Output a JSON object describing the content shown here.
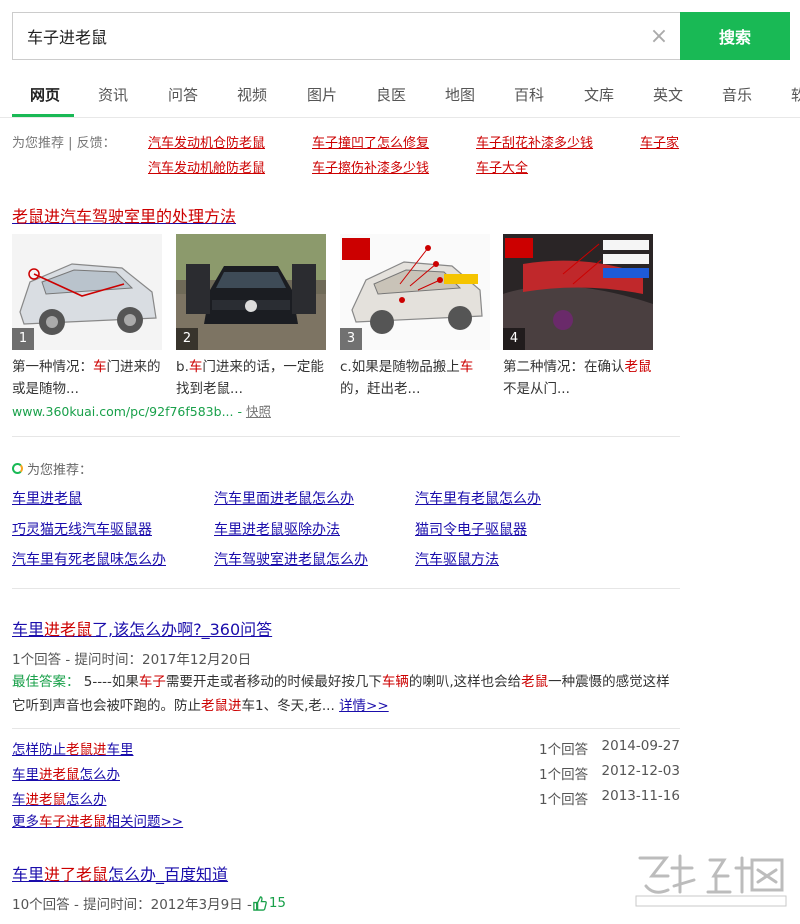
{
  "search": {
    "query": "车子进老鼠",
    "button": "搜索",
    "clear": "×"
  },
  "tabs": [
    "网页",
    "资讯",
    "问答",
    "视频",
    "图片",
    "良医",
    "地图",
    "百科",
    "文库",
    "英文",
    "音乐",
    "软"
  ],
  "recommend": {
    "label": "为您推荐 | 反馈：",
    "links": [
      "汽车发动机仓防老鼠",
      "车子撞凹了怎么修复",
      "车子刮花补漆多少钱",
      "车子家",
      "汽车发动机舱防老鼠",
      "车子擦伤补漆多少钱",
      "车子大全"
    ]
  },
  "result1": {
    "title": "老鼠进汽车驾驶室里的处理方法",
    "images": [
      {
        "num": "1",
        "cap_a": "第一种情况：",
        "cap_red": "车",
        "cap_b": "门进来的或是随物..."
      },
      {
        "num": "2",
        "cap_a": "b.",
        "cap_red": "车",
        "cap_b": "门进来的话，一定能找到老鼠..."
      },
      {
        "num": "3",
        "cap_a": "c.如果是随物品搬上",
        "cap_red": "车",
        "cap_b": "的，赶出老..."
      },
      {
        "num": "4",
        "cap_a": "第二种情况：在确认",
        "cap_red": "老鼠",
        "cap_b": "不是从门..."
      }
    ],
    "url": "www.360kuai.com/pc/92f76f583b...",
    "sep": " - ",
    "snapshot": "快照"
  },
  "related": {
    "heading": "为您推荐：",
    "links": [
      "车里进老鼠",
      "汽车里面进老鼠怎么办",
      "汽车里有老鼠怎么办",
      "巧灵猫无线汽车驱鼠器",
      "车里进老鼠驱除办法",
      "猫司令电子驱鼠器",
      "汽车里有死老鼠味怎么办",
      "汽车驾驶室进老鼠怎么办",
      "汽车驱鼠方法"
    ]
  },
  "result2": {
    "title_a": "车里",
    "title_red": "进老鼠",
    "title_b": "了,该怎么办啊?_360问答",
    "meta": "1个回答 - 提问时间：2017年12月20日",
    "best_label": "最佳答案：",
    "answer": [
      {
        "t": "5----如果",
        "r": false
      },
      {
        "t": "车子",
        "r": true
      },
      {
        "t": "需要开走或者移动的时候最好按几下",
        "r": false
      },
      {
        "t": "车辆",
        "r": true
      },
      {
        "t": "的喇叭,这样也会给",
        "r": false
      },
      {
        "t": "老鼠",
        "r": true
      },
      {
        "t": "一种震慑的感觉这样它听到声音也会被吓跑的。防止",
        "r": false
      },
      {
        "t": "老鼠进",
        "r": true
      },
      {
        "t": "车1、冬天,老...",
        "r": false
      }
    ],
    "more": "详情>>",
    "questions": [
      {
        "a": "怎样防止",
        "r": "老鼠进",
        "b": "车里",
        "count": "1个回答",
        "date": "2014-09-27"
      },
      {
        "a": "车里",
        "r": "进老鼠",
        "b": "怎么办",
        "count": "1个回答",
        "date": "2012-12-03"
      },
      {
        "a": "车",
        "r": "进老鼠",
        "b": "怎么办",
        "count": "1个回答",
        "date": "2013-11-16"
      }
    ],
    "more_a": "更多",
    "more_red": "车子进老鼠",
    "more_b": "相关问题>>"
  },
  "result3": {
    "title_a": "车里",
    "title_red": "进了老鼠",
    "title_b": "怎么办_百度知道",
    "meta": "10个回答 - 提问时间：2012年3月9日 - ",
    "likes": "15"
  },
  "colors": {
    "accent": "#19b955",
    "link": "#1a0dab",
    "highlight": "#c00000",
    "green_text": "#19a04a"
  }
}
